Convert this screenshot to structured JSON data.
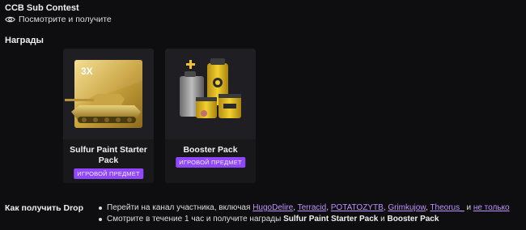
{
  "campaign": {
    "title": "CCB Sub Contest",
    "subtitle": "Посмотрите и получите"
  },
  "rewards": {
    "heading": "Награды",
    "items": [
      {
        "name": "Sulfur Paint Starter Pack",
        "badge": "ИГРОВОЙ ПРЕДМЕТ",
        "image_icon": "tank-3x-icon",
        "image_text": "3X"
      },
      {
        "name": "Booster Pack",
        "badge": "ИГРОВОЙ ПРЕДМЕТ",
        "image_icon": "booster-canisters-icon"
      }
    ]
  },
  "how_to": {
    "label": "Как получить Drop",
    "line1_prefix": "Перейти на канал участника, включая",
    "channels": [
      "HugoDelire",
      "Terracid",
      "POTATOZYTB",
      "Grimkujow",
      "Theorus_"
    ],
    "line1_and": "и",
    "more_link": "не только",
    "line2_prefix": "Смотрите в течение 1 час и получите награды",
    "reward1": "Sulfur Paint Starter Pack",
    "line2_and": "и",
    "reward2": "Booster Pack"
  },
  "colors": {
    "background": "#0e0e10",
    "card": "#18181b",
    "accent": "#9147ff",
    "link": "#bf94ff",
    "gold": "#c8a23a"
  }
}
